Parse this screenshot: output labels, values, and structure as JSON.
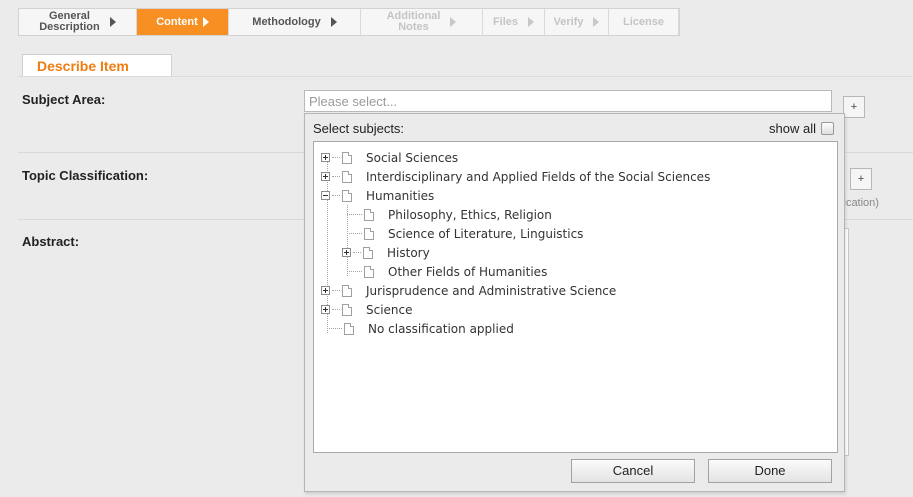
{
  "wizard": {
    "tabs": [
      {
        "label": "General\nDescription",
        "state": "normal"
      },
      {
        "label": "Content",
        "state": "active"
      },
      {
        "label": "Methodology",
        "state": "normal"
      },
      {
        "label": "Additional\nNotes",
        "state": "disabled"
      },
      {
        "label": "Files",
        "state": "disabled"
      },
      {
        "label": "Verify",
        "state": "disabled"
      },
      {
        "label": "License",
        "state": "disabled"
      }
    ]
  },
  "section": {
    "title": "Describe Item"
  },
  "fields": {
    "subject_area": {
      "label": "Subject Area:",
      "placeholder": "Please select...",
      "add_label": "+"
    },
    "topic_classification": {
      "label": "Topic Classification:",
      "add_label": "+",
      "hint": "ification)"
    },
    "abstract": {
      "label": "Abstract:"
    }
  },
  "dropdown": {
    "heading": "Select subjects:",
    "show_all_label": "show all",
    "show_all_checked": false,
    "tree": [
      {
        "label": "Social Sciences",
        "level": 0,
        "expander": "plus"
      },
      {
        "label": "Interdisciplinary and Applied Fields of the Social Sciences",
        "level": 0,
        "expander": "plus"
      },
      {
        "label": "Humanities",
        "level": 0,
        "expander": "minus"
      },
      {
        "label": "Philosophy, Ethics, Religion",
        "level": 1,
        "expander": "none"
      },
      {
        "label": "Science of Literature, Linguistics",
        "level": 1,
        "expander": "none"
      },
      {
        "label": "History",
        "level": 1,
        "expander": "plus"
      },
      {
        "label": "Other Fields of Humanities",
        "level": 1,
        "expander": "none"
      },
      {
        "label": "Jurisprudence and Administrative Science",
        "level": 0,
        "expander": "plus"
      },
      {
        "label": "Science",
        "level": 0,
        "expander": "plus"
      },
      {
        "label": "No classification applied",
        "level": 0,
        "expander": "none"
      }
    ],
    "cancel_label": "Cancel",
    "done_label": "Done"
  },
  "colors": {
    "accent": "#f78f22",
    "section_title": "#f07d12",
    "background": "#ebebeb"
  }
}
